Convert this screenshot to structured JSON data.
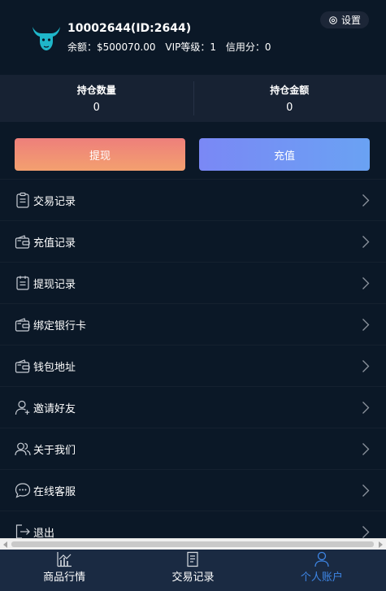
{
  "user": {
    "id_line": "10002644(ID:2644)",
    "balance": "余额：$500070.00",
    "vip": "VIP等级：1",
    "credit": "信用分：0",
    "logo_icon": "bull-logo-icon"
  },
  "settings": {
    "label": "设置",
    "icon": "gear-icon"
  },
  "stats": [
    {
      "label": "持仓数量",
      "value": "0"
    },
    {
      "label": "持仓金额",
      "value": "0"
    }
  ],
  "actions": {
    "withdraw": "提现",
    "deposit": "充值",
    "withdraw_gradient": [
      "#ee7f7b",
      "#f3a06f"
    ],
    "deposit_gradient": [
      "#7a88f5",
      "#6aa2f3"
    ]
  },
  "menu": [
    {
      "label": "交易记录",
      "icon": "clipboard-icon"
    },
    {
      "label": "充值记录",
      "icon": "wallet-icon"
    },
    {
      "label": "提现记录",
      "icon": "list-icon"
    },
    {
      "label": "绑定银行卡",
      "icon": "wallet-icon"
    },
    {
      "label": "钱包地址",
      "icon": "wallet-icon"
    },
    {
      "label": "邀请好友",
      "icon": "user-add-icon"
    },
    {
      "label": "关于我们",
      "icon": "users-icon"
    },
    {
      "label": "在线客服",
      "icon": "chat-icon"
    },
    {
      "label": "退出",
      "icon": "logout-icon"
    }
  ],
  "tabbar": [
    {
      "label": "商品行情",
      "icon": "chart-icon",
      "active": false
    },
    {
      "label": "交易记录",
      "icon": "document-icon",
      "active": false
    },
    {
      "label": "个人账户",
      "icon": "user-icon",
      "active": true
    }
  ],
  "colors": {
    "background": "#0b1827",
    "stats_bg": "#172233",
    "tabbar_bg": "#1a2a42",
    "active_tab": "#3e86e6",
    "logo": "#1fb6c9"
  }
}
